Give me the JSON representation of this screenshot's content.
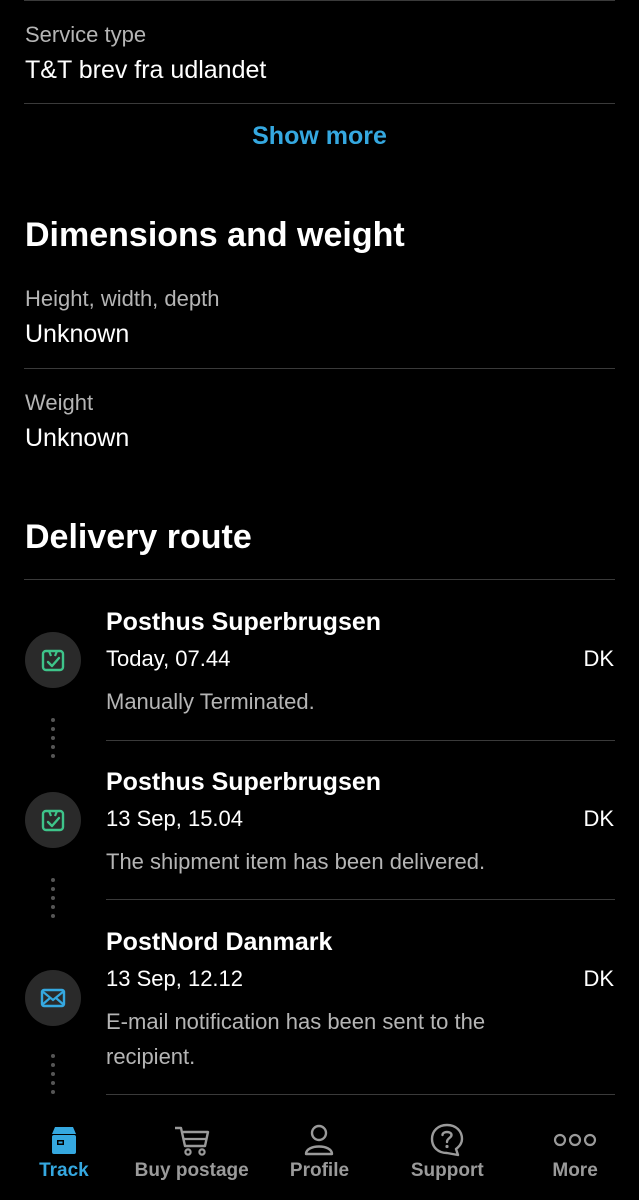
{
  "service": {
    "label": "Service type",
    "value": "T&T brev fra udlandet"
  },
  "show_more": "Show more",
  "dimensions": {
    "title": "Dimensions and weight",
    "size_label": "Height, width, depth",
    "size_value": "Unknown",
    "weight_label": "Weight",
    "weight_value": "Unknown"
  },
  "route": {
    "title": "Delivery route",
    "events": [
      {
        "location": "Posthus Superbrugsen",
        "time": "Today, 07.44",
        "country": "DK",
        "description": "Manually Terminated.",
        "icon": "package-check-icon"
      },
      {
        "location": "Posthus Superbrugsen",
        "time": "13 Sep, 15.04",
        "country": "DK",
        "description": "The shipment item has been delivered.",
        "icon": "package-check-icon"
      },
      {
        "location": "PostNord Danmark",
        "time": "13 Sep, 12.12",
        "country": "DK",
        "description": "E-mail notification has been sent to the recipient.",
        "icon": "envelope-icon"
      }
    ]
  },
  "tabs": [
    {
      "label": "Track",
      "icon": "package-icon",
      "active": true
    },
    {
      "label": "Buy postage",
      "icon": "cart-icon",
      "active": false
    },
    {
      "label": "Profile",
      "icon": "person-icon",
      "active": false
    },
    {
      "label": "Support",
      "icon": "question-icon",
      "active": false
    },
    {
      "label": "More",
      "icon": "more-dots-icon",
      "active": false
    }
  ],
  "colors": {
    "accent": "#35a8e0",
    "icon_green": "#3ec48a",
    "background": "#000000"
  }
}
